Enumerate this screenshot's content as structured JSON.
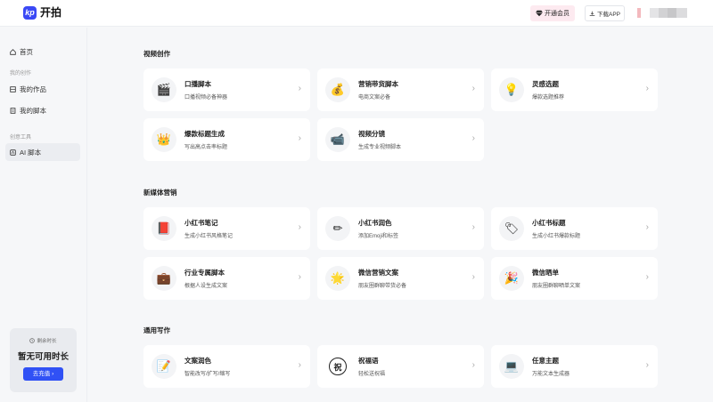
{
  "app": {
    "logo_mark": "kp",
    "name": "开拍"
  },
  "header": {
    "vip_label": "开通会员",
    "download_label": "下载APP"
  },
  "sidebar": {
    "home": "首页",
    "section_my": "我的创作",
    "my_works": "我的作品",
    "my_scripts": "我的脚本",
    "section_tools": "创意工具",
    "ai_script": "AI 脚本",
    "promo": {
      "sub": "剩余时长",
      "title": "暂无可用时长",
      "button": "去充值"
    }
  },
  "sections": [
    {
      "title": "视频创作",
      "cards": [
        {
          "icon": "clapperboard-icon",
          "emoji": "🎬",
          "title": "口播脚本",
          "desc": "口播视频必备神器"
        },
        {
          "icon": "money-bag-icon",
          "emoji": "💰",
          "title": "营销带货脚本",
          "desc": "电商文案必备"
        },
        {
          "icon": "lightbulb-icon",
          "emoji": "💡",
          "title": "灵感选题",
          "desc": "爆款选题推荐"
        },
        {
          "icon": "crown-icon",
          "emoji": "👑",
          "title": "爆款标题生成",
          "desc": "写出高点击率标题"
        },
        {
          "icon": "video-camera-icon",
          "emoji": "📹",
          "title": "视频分镜",
          "desc": "生成专业视频脚本"
        }
      ]
    },
    {
      "title": "新媒体营销",
      "cards": [
        {
          "icon": "red-book-icon",
          "emoji": "📕",
          "title": "小红书笔记",
          "desc": "生成小红书风格笔记"
        },
        {
          "icon": "pencil-icon",
          "emoji": "✏",
          "title": "小红书润色",
          "desc": "添加Emoji和标签"
        },
        {
          "icon": "eraser-icon",
          "emoji": "🏷",
          "title": "小红书标题",
          "desc": "生成小红书爆款标题"
        },
        {
          "icon": "briefcase-icon",
          "emoji": "💼",
          "title": "行业专属脚本",
          "desc": "根据人设生成文案"
        },
        {
          "icon": "star-icon",
          "emoji": "🌟",
          "title": "微信营销文案",
          "desc": "朋友圈群聊带货必备"
        },
        {
          "icon": "party-popper-icon",
          "emoji": "🎉",
          "title": "微信晒单",
          "desc": "朋友圈群聊晒单文案"
        }
      ]
    },
    {
      "title": "通用写作",
      "cards": [
        {
          "icon": "memo-icon",
          "emoji": "📝",
          "title": "文案润色",
          "desc": "智能改写/扩写/缩写"
        },
        {
          "icon": "blessing-icon",
          "emoji": "祝",
          "title": "祝福语",
          "desc": "轻松送祝福"
        },
        {
          "icon": "laptop-icon",
          "emoji": "💻",
          "title": "任意主题",
          "desc": "万能文本生成器"
        }
      ]
    }
  ],
  "colors": {
    "accent": "#3051f5",
    "logo": "#3b49f5",
    "vip_bg": "#fdeaf0",
    "page_bg": "#f6f7f9"
  }
}
